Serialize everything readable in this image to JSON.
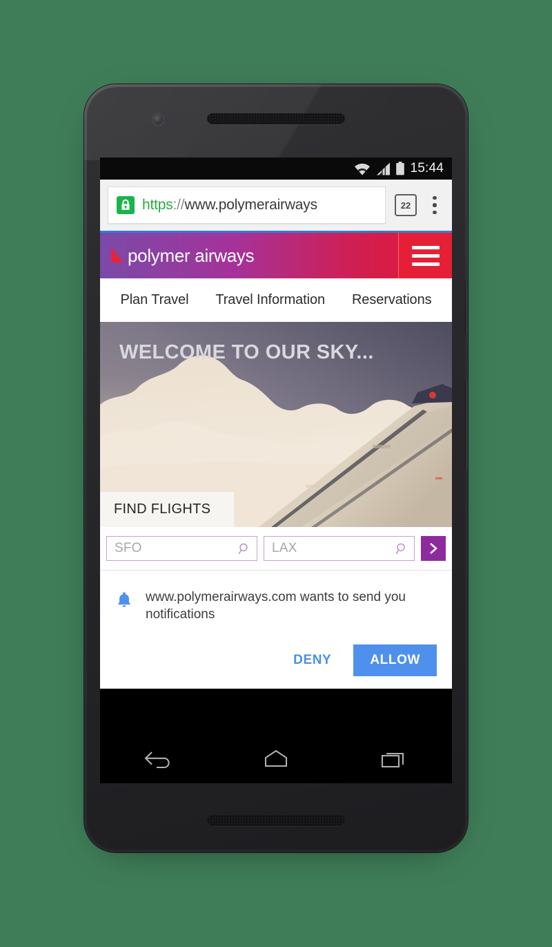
{
  "status_bar": {
    "time": "15:44",
    "icons": [
      "wifi-icon",
      "signal-icon",
      "battery-icon"
    ]
  },
  "browser": {
    "url_scheme": "https",
    "url_separator": "://",
    "url_host": "www.polymerairways",
    "security_icon": "lock-icon",
    "tab_count": "22",
    "menu_icon": "kebab-menu-icon",
    "progress_color": "#2f7fd8"
  },
  "site": {
    "brand_name": "polymer airways",
    "logo_icon": "airline-triangle-logo",
    "menu_icon": "hamburger-menu-icon",
    "header_gradient_start": "#7a4aa8",
    "header_gradient_end": "#e8172f",
    "menu_button_color": "#e51f35",
    "nav": [
      {
        "label": "Plan Travel"
      },
      {
        "label": "Travel Information"
      },
      {
        "label": "Reservations"
      }
    ]
  },
  "hero": {
    "title": "WELCOME TO OUR SKY...",
    "find_flights_label": "FIND FLIGHTS",
    "image_alt": "airplane-wing-above-clouds"
  },
  "search": {
    "origin_placeholder": "SFO",
    "origin_value": "",
    "destination_placeholder": "LAX",
    "destination_value": "",
    "search_icon": "magnifier-icon",
    "submit_icon": "chevron-right-icon",
    "submit_color": "#8e2a9e",
    "field_border_color": "#c99fd0"
  },
  "permission_dialog": {
    "icon": "bell-icon",
    "icon_color": "#5090ed",
    "origin": "www.polymerairways.com",
    "message": " wants to send you notifications",
    "deny_label": "DENY",
    "allow_label": "ALLOW",
    "allow_color": "#5090ed",
    "deny_color": "#4a90e8"
  },
  "android_nav": {
    "back_icon": "back-arrow-icon",
    "home_icon": "home-icon",
    "recents_icon": "recents-icon"
  }
}
